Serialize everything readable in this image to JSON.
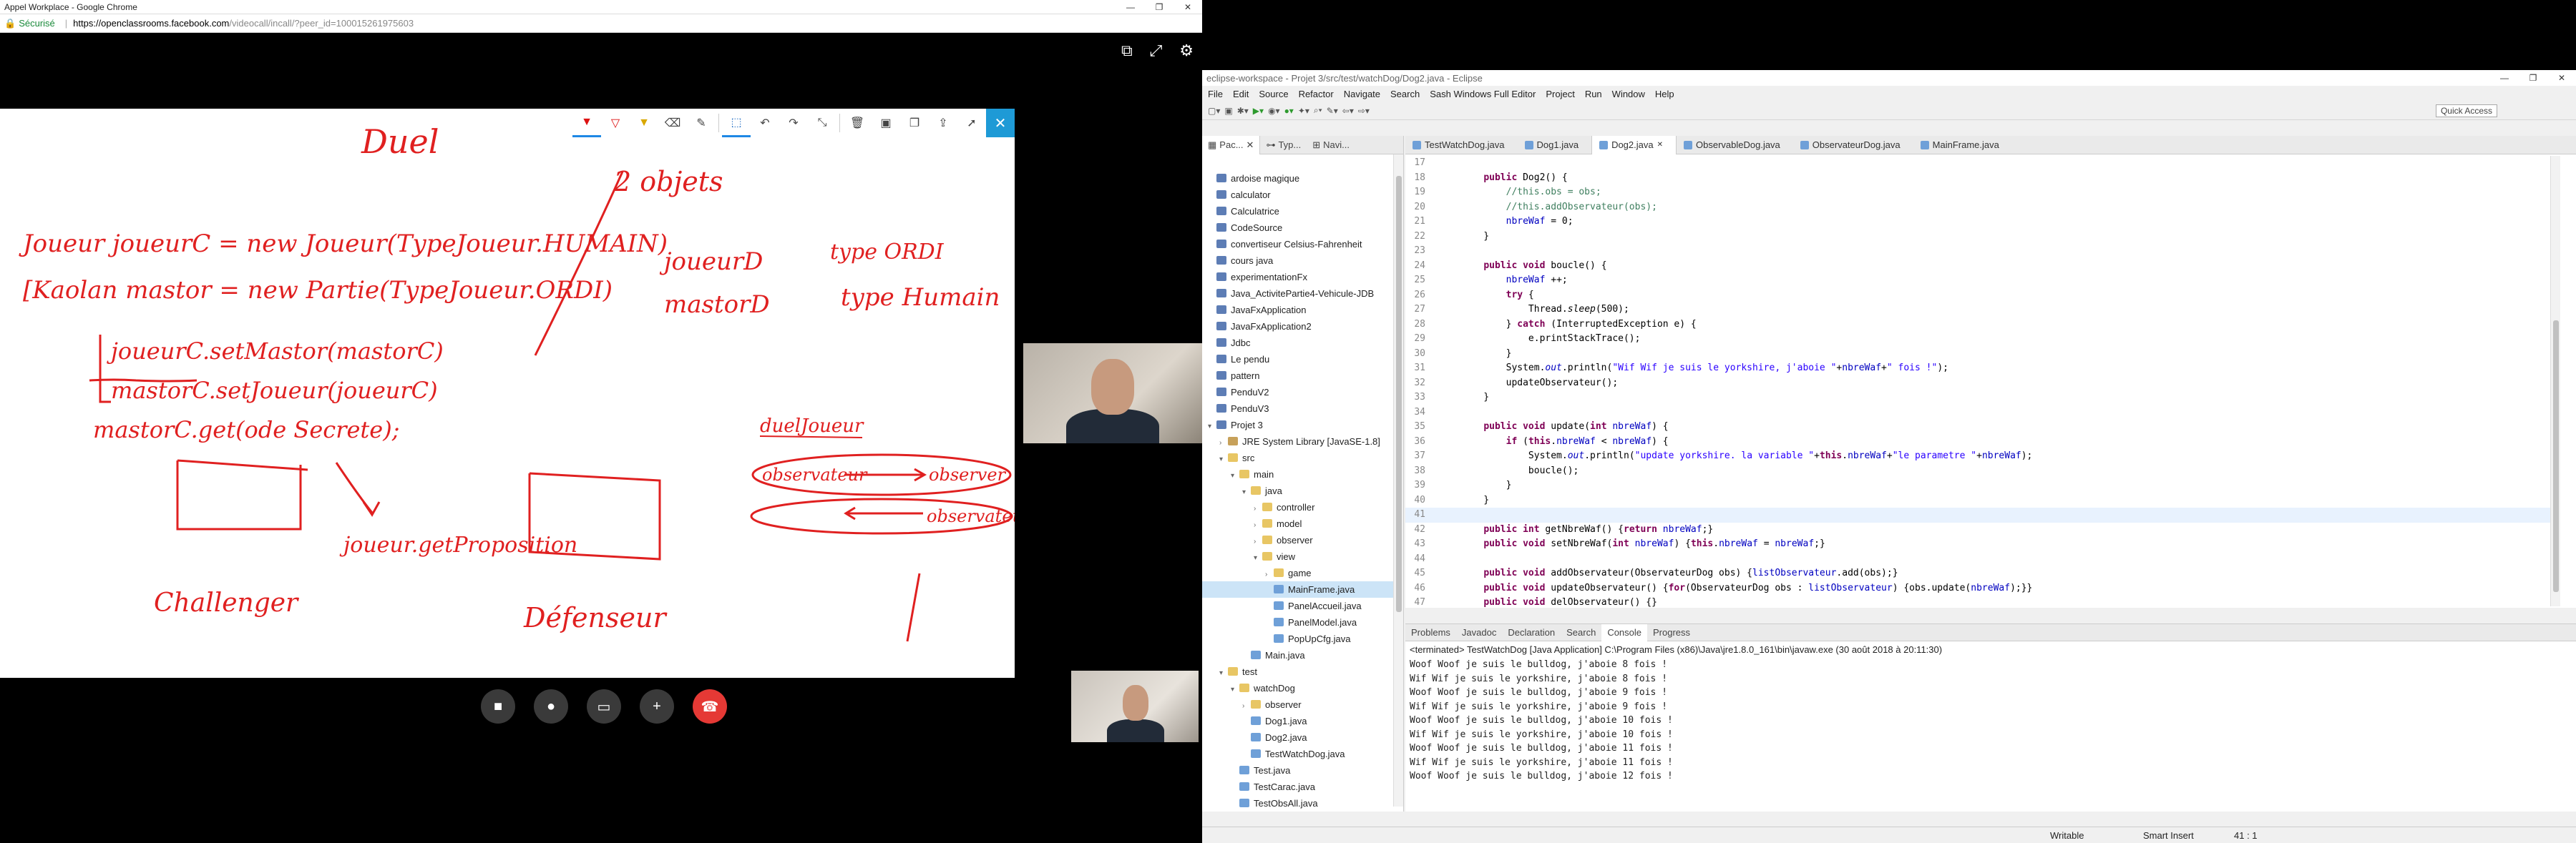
{
  "chrome": {
    "title": "Appel Workplace - Google Chrome",
    "win_min": "—",
    "win_max": "❐",
    "win_close": "✕",
    "secure_label": "Sécurisé",
    "url_host": "https://openclassrooms.facebook.com",
    "url_path": "/videocall/incall/?peer_id=100015261975603"
  },
  "whiteboard": {
    "title": "Duel",
    "lines": [
      "Joueur joueurC = new Joueur(TypeJoueur.HUMAIN)",
      "[Kaolan mastor = new Partie(TypeJoueur.ORDI)",
      "joueurC.setMastor(mastorC)",
      "mastorC.setJoueur(joueurC)",
      "mastorC.get(ode Secrete);",
      "2 objets",
      "joueurD",
      "mastorD",
      "type ORDI",
      "type Humain",
      "joueur.getProposition",
      "Challenger",
      "Défenseur",
      "duelJoueur",
      "observateur",
      "observer",
      "observateur"
    ]
  },
  "call": {
    "icons": [
      "screen-share-icon",
      "fullscreen-icon",
      "settings-icon"
    ],
    "controls": [
      "video-icon",
      "mic-icon",
      "screen-icon",
      "add-person-icon",
      "end-call-icon"
    ]
  },
  "eclipse": {
    "title": "eclipse-workspace - Projet 3/src/test/watchDog/Dog2.java - Eclipse",
    "menu": [
      "File",
      "Edit",
      "Source",
      "Refactor",
      "Navigate",
      "Search",
      "Sash Windows Full Editor",
      "Project",
      "Run",
      "Window",
      "Help"
    ],
    "quick_access": "Quick Access",
    "left_tabs": [
      "Pac...",
      "Typ...",
      "Navi..."
    ],
    "tree": [
      {
        "label": "ardoise magique",
        "icon": "proj",
        "indent": 0
      },
      {
        "label": "calculator",
        "icon": "proj",
        "indent": 0
      },
      {
        "label": "Calculatrice",
        "icon": "proj",
        "indent": 0
      },
      {
        "label": "CodeSource",
        "icon": "proj",
        "indent": 0
      },
      {
        "label": "convertiseur Celsius-Fahrenheit",
        "icon": "proj",
        "indent": 0
      },
      {
        "label": "cours java",
        "icon": "proj",
        "indent": 0
      },
      {
        "label": "experimentationFx",
        "icon": "proj",
        "indent": 0
      },
      {
        "label": "Java_ActivitePartie4-Vehicule-JDB",
        "icon": "proj",
        "indent": 0
      },
      {
        "label": "JavaFxApplication",
        "icon": "proj",
        "indent": 0
      },
      {
        "label": "JavaFxApplication2",
        "icon": "proj",
        "indent": 0
      },
      {
        "label": "Jdbc",
        "icon": "proj",
        "indent": 0
      },
      {
        "label": "Le pendu",
        "icon": "proj",
        "indent": 0
      },
      {
        "label": "pattern",
        "icon": "proj",
        "indent": 0
      },
      {
        "label": "PenduV2",
        "icon": "proj",
        "indent": 0
      },
      {
        "label": "PenduV3",
        "icon": "proj",
        "indent": 0
      },
      {
        "label": "Projet 3",
        "icon": "proj",
        "indent": 0
      },
      {
        "label": "JRE System Library [JavaSE-1.8]",
        "icon": "lib",
        "indent": 1
      },
      {
        "label": "src",
        "icon": "fold",
        "indent": 1
      },
      {
        "label": "main",
        "icon": "fold",
        "indent": 2
      },
      {
        "label": "java",
        "icon": "fold",
        "indent": 3
      },
      {
        "label": "controller",
        "icon": "fold",
        "indent": 4
      },
      {
        "label": "model",
        "icon": "fold",
        "indent": 4
      },
      {
        "label": "observer",
        "icon": "fold",
        "indent": 4
      },
      {
        "label": "view",
        "icon": "fold",
        "indent": 4
      },
      {
        "label": "game",
        "icon": "fold",
        "indent": 5
      },
      {
        "label": "MainFrame.java",
        "icon": "jfile",
        "indent": 5
      },
      {
        "label": "PanelAccueil.java",
        "icon": "jfile",
        "indent": 5
      },
      {
        "label": "PanelModel.java",
        "icon": "jfile",
        "indent": 5
      },
      {
        "label": "PopUpCfg.java",
        "icon": "jfile",
        "indent": 5
      },
      {
        "label": "Main.java",
        "icon": "jfile",
        "indent": 3
      },
      {
        "label": "test",
        "icon": "fold",
        "indent": 1
      },
      {
        "label": "watchDog",
        "icon": "fold",
        "indent": 2
      },
      {
        "label": "observer",
        "icon": "fold",
        "indent": 3
      },
      {
        "label": "Dog1.java",
        "icon": "jfile",
        "indent": 3
      },
      {
        "label": "Dog2.java",
        "icon": "jfile",
        "indent": 3
      },
      {
        "label": "TestWatchDog.java",
        "icon": "jfile",
        "indent": 3
      },
      {
        "label": "Test.java",
        "icon": "jfile",
        "indent": 2
      },
      {
        "label": "TestCarac.java",
        "icon": "jfile",
        "indent": 2
      },
      {
        "label": "TestObsAll.java",
        "icon": "jfile",
        "indent": 2
      }
    ],
    "editor_tabs": [
      "TestWatchDog.java",
      "Dog1.java",
      "Dog2.java",
      "ObservableDog.java",
      "ObservateurDog.java",
      "MainFrame.java"
    ],
    "active_tab": "Dog2.java",
    "code": [
      {
        "n": "17",
        "t": ""
      },
      {
        "n": "18",
        "t": "    public Dog2() {"
      },
      {
        "n": "19",
        "t": "        //this.obs = obs;"
      },
      {
        "n": "20",
        "t": "        //this.addObservateur(obs);"
      },
      {
        "n": "21",
        "t": "        nbreWaf = 0;"
      },
      {
        "n": "22",
        "t": "    }"
      },
      {
        "n": "23",
        "t": ""
      },
      {
        "n": "24",
        "t": "    public void boucle() {"
      },
      {
        "n": "25",
        "t": "        nbreWaf ++;"
      },
      {
        "n": "26",
        "t": "        try {"
      },
      {
        "n": "27",
        "t": "            Thread.sleep(500);"
      },
      {
        "n": "28",
        "t": "        } catch (InterruptedException e) {"
      },
      {
        "n": "29",
        "t": "            e.printStackTrace();"
      },
      {
        "n": "30",
        "t": "        }"
      },
      {
        "n": "31",
        "t": "        System.out.println(\"Wif Wif je suis le yorkshire, j'aboie \"+nbreWaf+\" fois !\");"
      },
      {
        "n": "32",
        "t": "        updateObservateur();"
      },
      {
        "n": "33",
        "t": "    }"
      },
      {
        "n": "34",
        "t": ""
      },
      {
        "n": "35",
        "t": "    public void update(int nbreWaf) {"
      },
      {
        "n": "36",
        "t": "        if (this.nbreWaf < nbreWaf) {"
      },
      {
        "n": "37",
        "t": "            System.out.println(\"update yorkshire. la variable \"+this.nbreWaf+\"le parametre \"+nbreWaf);"
      },
      {
        "n": "38",
        "t": "            boucle();"
      },
      {
        "n": "39",
        "t": "        }"
      },
      {
        "n": "40",
        "t": "    }"
      },
      {
        "n": "41",
        "t": ""
      },
      {
        "n": "42",
        "t": "    public int getNbreWaf() {return nbreWaf;}"
      },
      {
        "n": "43",
        "t": "    public void setNbreWaf(int nbreWaf) {this.nbreWaf = nbreWaf;}"
      },
      {
        "n": "44",
        "t": ""
      },
      {
        "n": "45",
        "t": "    public void addObservateur(ObservateurDog obs) {listObservateur.add(obs);}"
      },
      {
        "n": "46",
        "t": "    public void updateObservateur() {for(ObservateurDog obs : listObservateur) {obs.update(nbreWaf);}}"
      },
      {
        "n": "47",
        "t": "    public void delObservateur() {}"
      }
    ],
    "console_tabs": [
      "Problems",
      "Javadoc",
      "Declaration",
      "Search",
      "Console",
      "Progress"
    ],
    "console_active": "Console",
    "console_header": "<terminated> TestWatchDog [Java Application] C:\\Program Files (x86)\\Java\\jre1.8.0_161\\bin\\javaw.exe (30 août 2018 à 20:11:30)",
    "console_lines": [
      "Woof Woof je suis le bulldog, j'aboie 8 fois !",
      "Wif Wif je suis le yorkshire, j'aboie 8 fois !",
      "Woof Woof je suis le bulldog, j'aboie 9 fois !",
      "Wif Wif je suis le yorkshire, j'aboie 9 fois !",
      "Woof Woof je suis le bulldog, j'aboie 10 fois !",
      "Wif Wif je suis le yorkshire, j'aboie 10 fois !",
      "Woof Woof je suis le bulldog, j'aboie 11 fois !",
      "Wif Wif je suis le yorkshire, j'aboie 11 fois !",
      "Woof Woof je suis le bulldog, j'aboie 12 fois !"
    ],
    "status_writable": "Writable",
    "status_insert": "Smart Insert",
    "status_pos": "41 : 1"
  }
}
